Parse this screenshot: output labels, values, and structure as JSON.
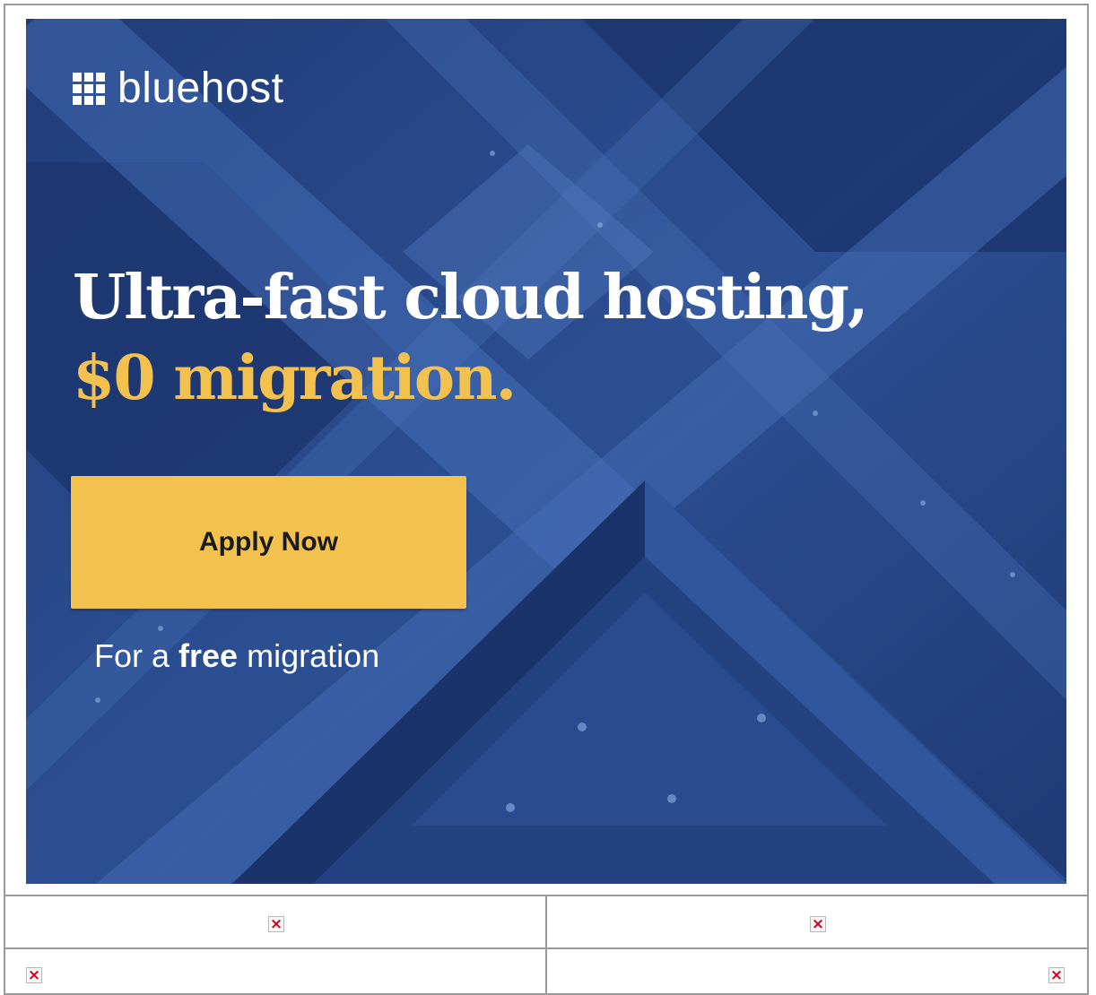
{
  "brand": {
    "name": "bluehost",
    "logo_icon": "grid-icon"
  },
  "headline": {
    "line1": "Ultra-fast cloud hosting,",
    "line2": "$0 migration."
  },
  "cta": {
    "label": "Apply Now"
  },
  "subtext": {
    "prefix": "For a ",
    "emphasis": "free",
    "suffix": " migration"
  },
  "colors": {
    "background_blue": "#23407f",
    "accent_yellow": "#f2c14e",
    "text_white": "#ffffff",
    "button_text": "#1b1b1b"
  },
  "broken_images": [
    {
      "icon": "broken-image-icon"
    },
    {
      "icon": "broken-image-icon"
    },
    {
      "icon": "broken-image-icon"
    },
    {
      "icon": "broken-image-icon"
    }
  ]
}
